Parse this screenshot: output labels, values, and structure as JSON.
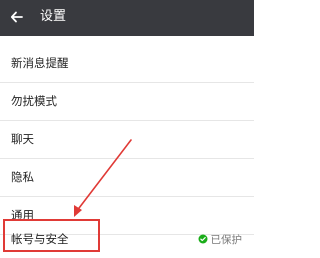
{
  "header": {
    "back_icon": "back-arrow-icon",
    "title": "设置"
  },
  "settings": {
    "items": [
      {
        "label": "新消息提醒"
      },
      {
        "label": "勿扰模式"
      },
      {
        "label": "聊天"
      },
      {
        "label": "隐私"
      },
      {
        "label": "通用"
      },
      {
        "label": "帐号与安全",
        "status": "已保护",
        "status_icon": "protected-shield-icon"
      }
    ]
  },
  "annotation": {
    "highlight_color": "#e03a36",
    "icon": "pointer-arrow-icon"
  },
  "colors": {
    "topbar_bg": "#393a3f",
    "status_green": "#1aad19"
  }
}
